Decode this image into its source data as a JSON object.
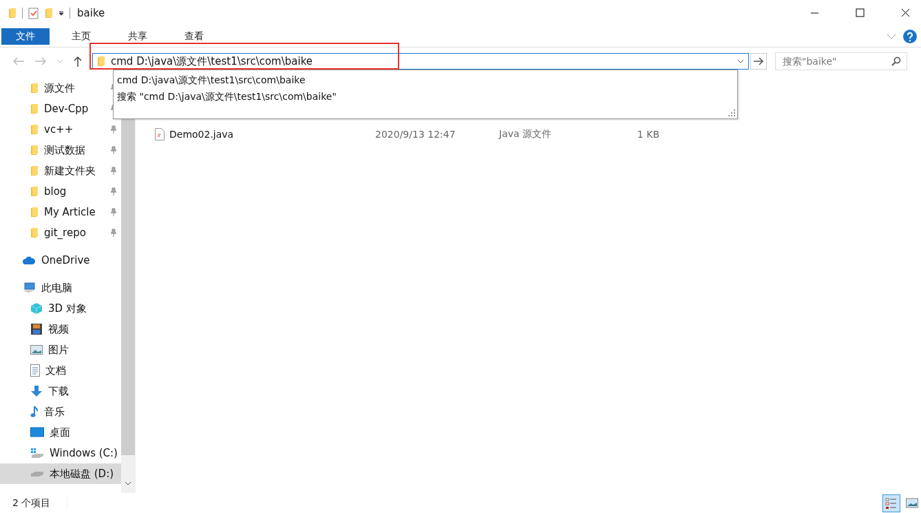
{
  "window": {
    "title": "baike"
  },
  "ribbon": {
    "tabs": [
      {
        "label": "文件",
        "kind": "file",
        "selected": false
      },
      {
        "label": "主页",
        "kind": "tab",
        "selected": false
      },
      {
        "label": "共享",
        "kind": "tab",
        "selected": false
      },
      {
        "label": "查看",
        "kind": "tab",
        "selected": false
      }
    ]
  },
  "address_bar": {
    "value": "cmd D:\\java\\源文件\\test1\\src\\com\\baike",
    "suggestions": [
      "cmd D:\\java\\源文件\\test1\\src\\com\\baike",
      "搜索 \"cmd D:\\java\\源文件\\test1\\src\\com\\baike\""
    ]
  },
  "search": {
    "placeholder": "搜索\"baike\""
  },
  "sidebar": {
    "quick_access": [
      {
        "label": "源文件",
        "pinned": true
      },
      {
        "label": "Dev-Cpp",
        "pinned": true
      },
      {
        "label": "vc++",
        "pinned": true
      },
      {
        "label": "测试数据",
        "pinned": true
      },
      {
        "label": "新建文件夹",
        "pinned": true
      },
      {
        "label": "blog",
        "pinned": true
      },
      {
        "label": "My Article",
        "pinned": true
      },
      {
        "label": "git_repo",
        "pinned": true
      }
    ],
    "items": [
      {
        "label": "OneDrive",
        "kind": "cloud",
        "selected": false
      },
      {
        "label": "此电脑",
        "kind": "pc",
        "selected": false,
        "children": [
          {
            "label": "3D 对象",
            "kind": "cube",
            "selected": false
          },
          {
            "label": "视频",
            "kind": "video",
            "selected": false
          },
          {
            "label": "图片",
            "kind": "picture",
            "selected": false
          },
          {
            "label": "文档",
            "kind": "document",
            "selected": false
          },
          {
            "label": "下载",
            "kind": "download",
            "selected": false
          },
          {
            "label": "音乐",
            "kind": "music",
            "selected": false
          },
          {
            "label": "桌面",
            "kind": "desktop",
            "selected": false
          },
          {
            "label": "Windows (C:)",
            "kind": "windrive",
            "selected": false
          },
          {
            "label": "本地磁盘 (D:)",
            "kind": "drive",
            "selected": true
          }
        ]
      }
    ]
  },
  "files": [
    {
      "name": "Demo02.java",
      "date": "2020/9/13 12:47",
      "type": "Java 源文件",
      "size": "1 KB"
    }
  ],
  "status_bar": {
    "count": "2 个项目",
    "views": [
      {
        "kind": "details",
        "selected": true
      },
      {
        "kind": "large",
        "selected": false
      }
    ]
  }
}
